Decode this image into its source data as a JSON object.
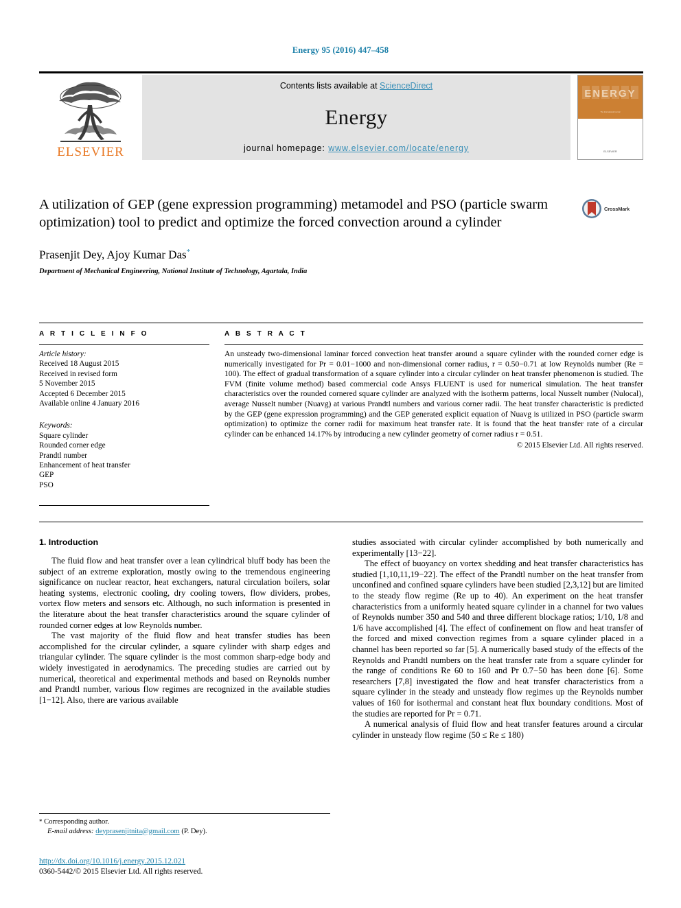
{
  "running_head": "Energy 95 (2016) 447–458",
  "banner": {
    "publisher": "ELSEVIER",
    "contents_prefix": "Contents lists available at ",
    "contents_link": "ScienceDirect",
    "journal_name": "Energy",
    "homepage_prefix": "journal homepage: ",
    "homepage_url": "www.elsevier.com/locate/energy",
    "cover_title": "ENERGY",
    "cover_sub": "The International Journal",
    "cover_publisher": "ELSEVIER"
  },
  "article": {
    "title": "A utilization of GEP (gene expression programming) metamodel and PSO (particle swarm optimization) tool to predict and optimize the forced convection around a cylinder",
    "crossmark_label": "CrossMark",
    "authors": "Prasenjit Dey, Ajoy Kumar Das",
    "author_marker": "*",
    "affiliation": "Department of Mechanical Engineering, National Institute of Technology, Agartala, India"
  },
  "info": {
    "heading": "A R T I C L E   I N F O",
    "history_label": "Article history:",
    "history": [
      "Received 18 August 2015",
      "Received in revised form",
      "5 November 2015",
      "Accepted 6 December 2015",
      "Available online 4 January 2016"
    ],
    "keywords_label": "Keywords:",
    "keywords": [
      "Square cylinder",
      "Rounded corner edge",
      "Prandtl number",
      "Enhancement of heat transfer",
      "GEP",
      "PSO"
    ]
  },
  "abstract": {
    "heading": "A B S T R A C T",
    "text": "An unsteady two-dimensional laminar forced convection heat transfer around a square cylinder with the rounded corner edge is numerically investigated for Pr = 0.01−1000 and non-dimensional corner radius, r = 0.50−0.71 at low Reynolds number (Re = 100). The effect of gradual transformation of a square cylinder into a circular cylinder on heat transfer phenomenon is studied. The FVM (finite volume method) based commercial code Ansys FLUENT is used for numerical simulation. The heat transfer characteristics over the rounded cornered square cylinder are analyzed with the isotherm patterns, local Nusselt number (Nulocal), average Nusselt number (Nuavg) at various Prandtl numbers and various corner radii. The heat transfer characteristic is predicted by the GEP (gene expression programming) and the GEP generated explicit equation of Nuavg is utilized in PSO (particle swarm optimization) to optimize the corner radii for maximum heat transfer rate. It is found that the heat transfer rate of a circular cylinder can be enhanced 14.17% by introducing a new cylinder geometry of corner radius r = 0.51.",
    "copyright": "© 2015 Elsevier Ltd. All rights reserved."
  },
  "body": {
    "section_heading": "1. Introduction",
    "left_paragraphs": [
      "The fluid flow and heat transfer over a lean cylindrical bluff body has been the subject of an extreme exploration, mostly owing to the tremendous engineering significance on nuclear reactor, heat exchangers, natural circulation boilers, solar heating systems, electronic cooling, dry cooling towers, flow dividers, probes, vortex flow meters and sensors etc. Although, no such information is presented in the literature about the heat transfer characteristics around the square cylinder of rounded corner edges at low Reynolds number.",
      "The vast majority of the fluid flow and heat transfer studies has been accomplished for the circular cylinder, a square cylinder with sharp edges and triangular cylinder. The square cylinder is the most common sharp-edge body and widely investigated in aerodynamics. The preceding studies are carried out by numerical, theoretical and experimental methods and based on Reynolds number and Prandtl number, various flow regimes are recognized in the available studies [1−12]. Also, there are various available"
    ],
    "right_paragraphs": [
      "studies associated with circular cylinder accomplished by both numerically and experimentally [13−22].",
      "The effect of buoyancy on vortex shedding and heat transfer characteristics has studied [1,10,11,19−22]. The effect of the Prandtl number on the heat transfer from unconfined and confined square cylinders have been studied [2,3,12] but are limited to the steady flow regime (Re up to 40). An experiment on the heat transfer characteristics from a uniformly heated square cylinder in a channel for two values of Reynolds number 350 and 540 and three different blockage ratios; 1/10, 1/8 and 1/6 have accomplished [4]. The effect of confinement on flow and heat transfer of the forced and mixed convection regimes from a square cylinder placed in a channel has been reported so far [5]. A numerically based study of the effects of the Reynolds and Prandtl numbers on the heat transfer rate from a square cylinder for the range of conditions Re 60 to 160 and Pr 0.7−50 has been done [6]. Some researchers [7,8] investigated the flow and heat transfer characteristics from a square cylinder in the steady and unsteady flow regimes up the Reynolds number values of 160 for isothermal and constant heat flux boundary conditions. Most of the studies are reported for Pr = 0.71.",
      "A numerical analysis of fluid flow and heat transfer features around a circular cylinder in unsteady flow regime (50 ≤ Re ≤ 180)"
    ]
  },
  "footer": {
    "corresponding_marker": "*",
    "corresponding_label": "Corresponding author.",
    "email_label": "E-mail address:",
    "email": "deyprasenjitnita@gmail.com",
    "email_suffix": "(P. Dey).",
    "doi": "http://dx.doi.org/10.1016/j.energy.2015.12.021",
    "issn_line": "0360-5442/© 2015 Elsevier Ltd. All rights reserved."
  },
  "colors": {
    "link": "#1a7fa8",
    "elsevier_orange": "#e87722",
    "banner_grey": "#e3e3e3",
    "cover_orange": "#cc8033"
  }
}
